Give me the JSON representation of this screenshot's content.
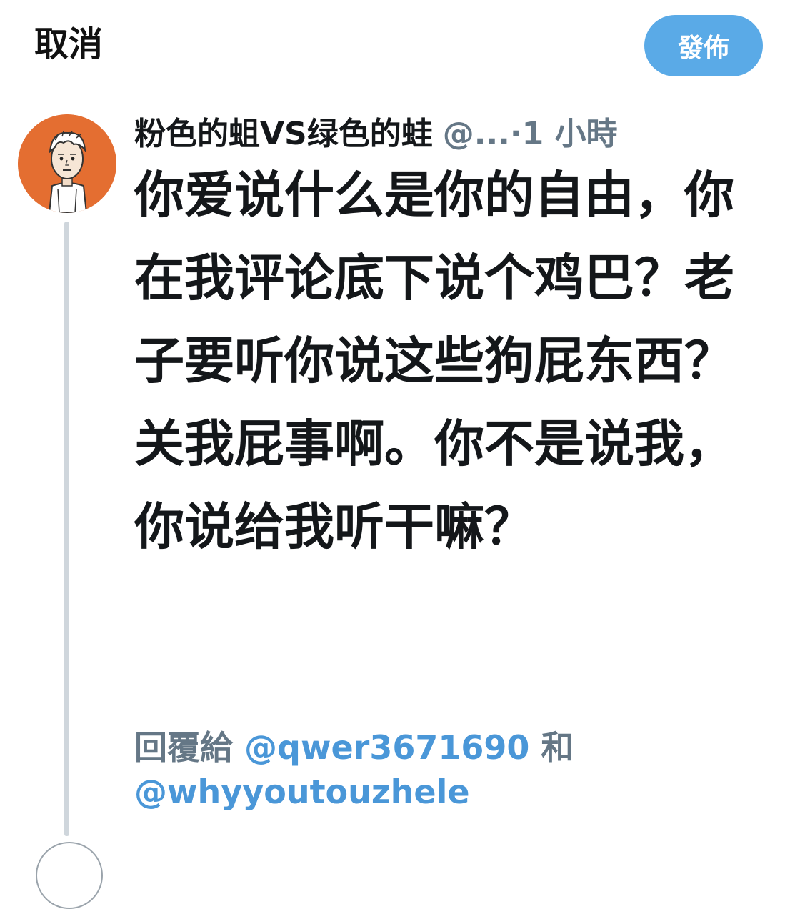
{
  "header": {
    "cancel_label": "取消",
    "post_label": "發佈"
  },
  "tweet": {
    "display_name": "粉色的蛆VS绿色的蛙",
    "handle": "@...",
    "separator": "·",
    "time": "1 小時",
    "text": "你爱说什么是你的自由，你在我评论底下说个鸡巴？老子要听你说这些狗屁东西？关我屁事啊。你不是说我，你说给我听干嘛？"
  },
  "reply": {
    "prefix": "回覆給",
    "mention_1": "@qwer3671690",
    "conjunction": "和",
    "mention_2": "@whyyoutouzhele"
  },
  "colors": {
    "accent": "#5aaae7",
    "link": "#4a97d8",
    "muted": "#657786",
    "text": "#14171a",
    "avatar_bg": "#e46e31",
    "thread_line": "#cfd6dc"
  },
  "icons": {
    "avatar": "cartoon-boy-avatar"
  }
}
